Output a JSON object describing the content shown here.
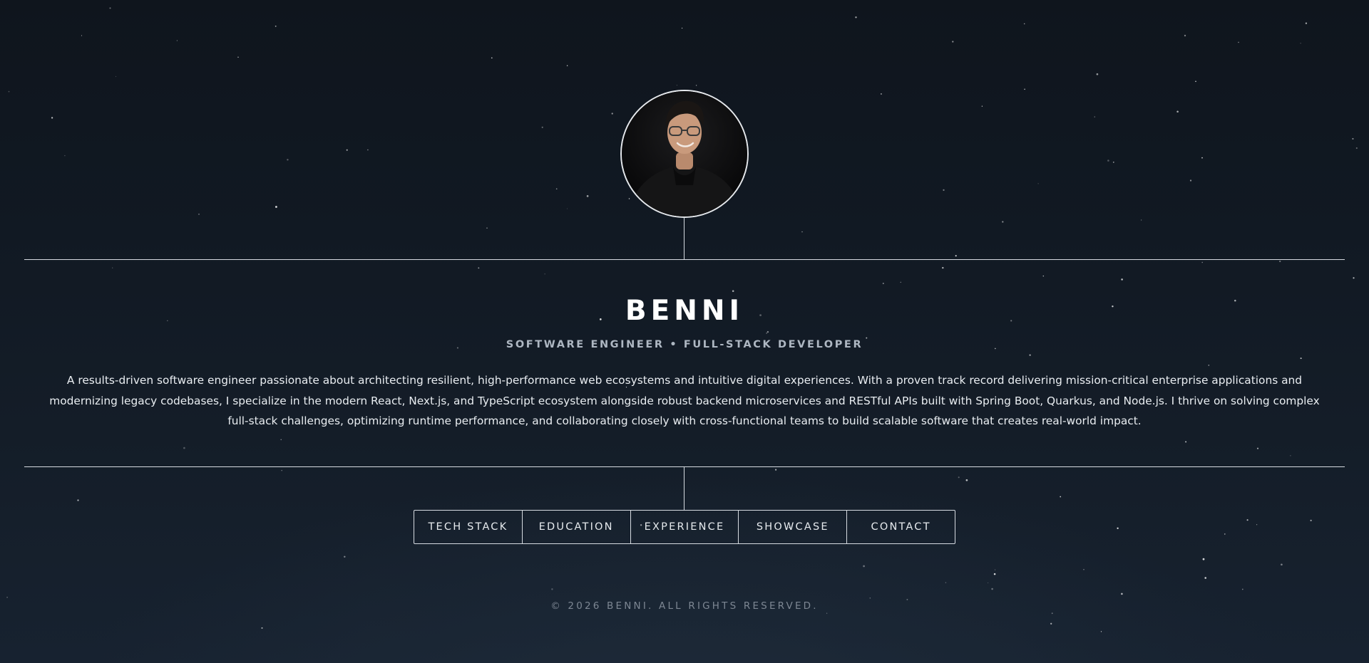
{
  "profile": {
    "name": "BENNI",
    "subtitle": "SOFTWARE ENGINEER • FULL-STACK DEVELOPER",
    "bio": "A results-driven software engineer passionate about architecting resilient, high-performance web ecosystems and intuitive digital experiences. With a proven track record delivering mission-critical enterprise applications and modernizing legacy codebases, I specialize in the modern React, Next.js, and TypeScript ecosystem alongside robust backend microservices and RESTful APIs built with Spring Boot, Quarkus, and Node.js. I thrive on solving complex full-stack challenges, optimizing runtime performance, and collaborating closely with cross-functional teams to build scalable software that creates real-world impact.",
    "avatar_icon": "portrait-photo"
  },
  "nav": {
    "items": [
      {
        "label": "TECH STACK"
      },
      {
        "label": "EDUCATION"
      },
      {
        "label": "EXPERIENCE"
      },
      {
        "label": "SHOWCASE"
      },
      {
        "label": "CONTACT"
      }
    ]
  },
  "footer": {
    "copyright": "© 2026 BENNI. ALL RIGHTS RESERVED."
  },
  "theme": {
    "background": "#111923",
    "line": "#d6dbe1",
    "text": "#ffffff",
    "muted": "#aeb7c2"
  }
}
